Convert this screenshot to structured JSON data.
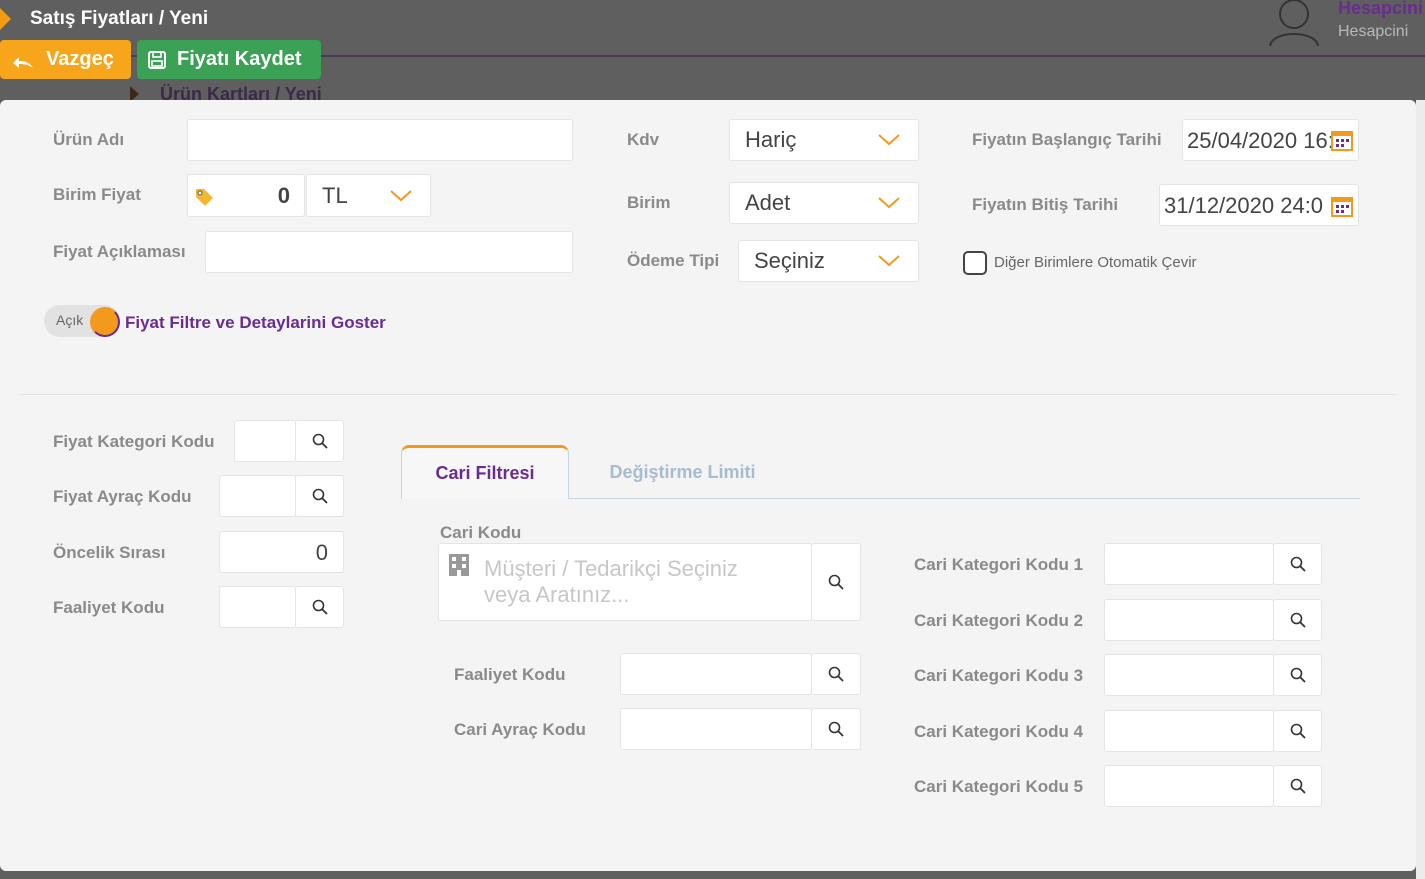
{
  "header": {
    "title": "Satış Fiyatları / Yeni",
    "user_name": "Hesapcini",
    "user_sub": "Hesapcini",
    "background_breadcrumb": "Ürün Kartları / Yeni",
    "cancel_label": "Vazgeç",
    "save_label": "Fiyatı Kaydet"
  },
  "form": {
    "product_name_label": "Ürün Adı",
    "unit_price_label": "Birim Fiyat",
    "unit_price_value": "0",
    "currency_value": "TL",
    "price_desc_label": "Fiyat Açıklaması",
    "kdv_label": "Kdv",
    "kdv_value": "Hariç",
    "unit_label": "Birim",
    "unit_value": "Adet",
    "payment_label": "Ödeme Tipi",
    "payment_value": "Seçiniz",
    "start_date_label": "Fiyatın Başlangıç Tarihi",
    "start_date_value": "25/04/2020 16:",
    "end_date_label": "Fiyatın Bitiş Tarihi",
    "end_date_value": "31/12/2020 24:0",
    "auto_convert_label": "Diğer Birimlere Otomatik Çevir",
    "toggle_state": "Açık",
    "toggle_link": "Fiyat Filtre ve Detaylarini Goster"
  },
  "left_filters": {
    "category_label": "Fiyat Kategori Kodu",
    "separator_label": "Fiyat Ayraç Kodu",
    "priority_label": "Öncelik Sırası",
    "priority_value": "0",
    "activity_label": "Faaliyet Kodu"
  },
  "tabs": {
    "active": "Cari Filtresi",
    "inactive": "Değiştirme Limiti"
  },
  "cari": {
    "code_label": "Cari Kodu",
    "code_placeholder_1": "Müşteri / Tedarikçi Seçiniz",
    "code_placeholder_2": "veya Aratınız...",
    "activity_label": "Faaliyet Kodu",
    "separator_label": "Cari Ayraç Kodu",
    "cat1": "Cari Kategori Kodu 1",
    "cat2": "Cari Kategori Kodu 2",
    "cat3": "Cari Kategori Kodu 3",
    "cat4": "Cari Kategori Kodu 4",
    "cat5": "Cari Kategori Kodu 5"
  },
  "colors": {
    "accent_orange": "#f39a1d",
    "accent_purple": "#6a2c8e",
    "save_green": "#3aa155"
  }
}
